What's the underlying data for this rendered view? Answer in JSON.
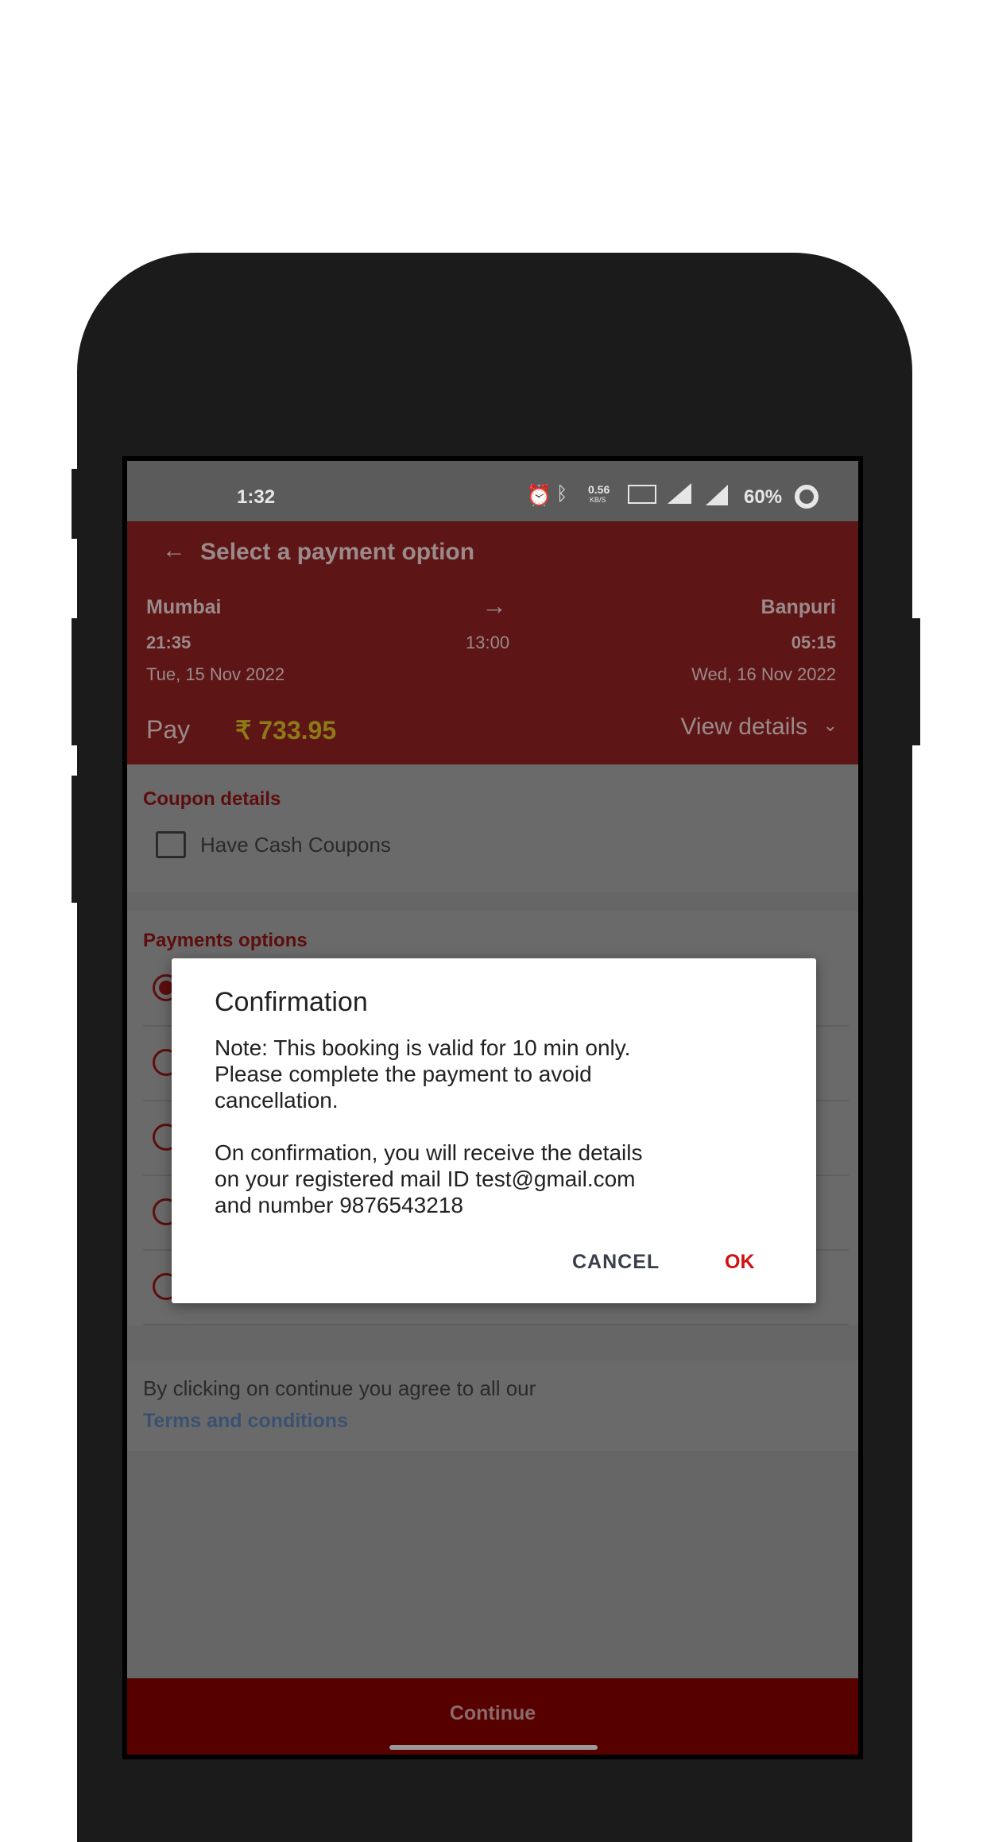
{
  "status_bar": {
    "time": "1:32",
    "net_speed": "0.56",
    "net_unit": "KB/S",
    "battery": "60%",
    "icons": [
      "alarm-icon",
      "bluetooth-icon",
      "volte-icon",
      "4g-signal-icon",
      "signal-icon",
      "battery-icon"
    ]
  },
  "header": {
    "title": "Select a payment option",
    "from_city": "Mumbai",
    "to_city": "Banpuri",
    "dep_time": "21:35",
    "duration": "13:00",
    "arr_time": "05:15",
    "dep_date": "Tue, 15 Nov 2022",
    "arr_date": "Wed, 16 Nov 2022",
    "pay_label": "Pay",
    "amount": "₹ 733.95",
    "view_details": "View details"
  },
  "coupon": {
    "title": "Coupon details",
    "checkbox_label": "Have Cash Coupons",
    "checked": false
  },
  "payments": {
    "title": "Payments options",
    "selected_index": 0,
    "option_count": 5
  },
  "terms": {
    "text": "By clicking on continue you agree to all our",
    "link": "Terms and conditions"
  },
  "continue_label": "Continue",
  "dialog": {
    "title": "Confirmation",
    "line1": "Note: This booking is valid for 10 min only.",
    "line2": "Please complete the payment to avoid",
    "line3": "cancellation.",
    "line4": "On confirmation, you will receive the details",
    "line5": "on your registered mail ID test@gmail.com",
    "line6": "and number 9876543218",
    "cancel": "CANCEL",
    "ok": "OK"
  },
  "colors": {
    "brand": "#8b0000",
    "ok": "#d01010",
    "link": "#3b6cb0"
  }
}
